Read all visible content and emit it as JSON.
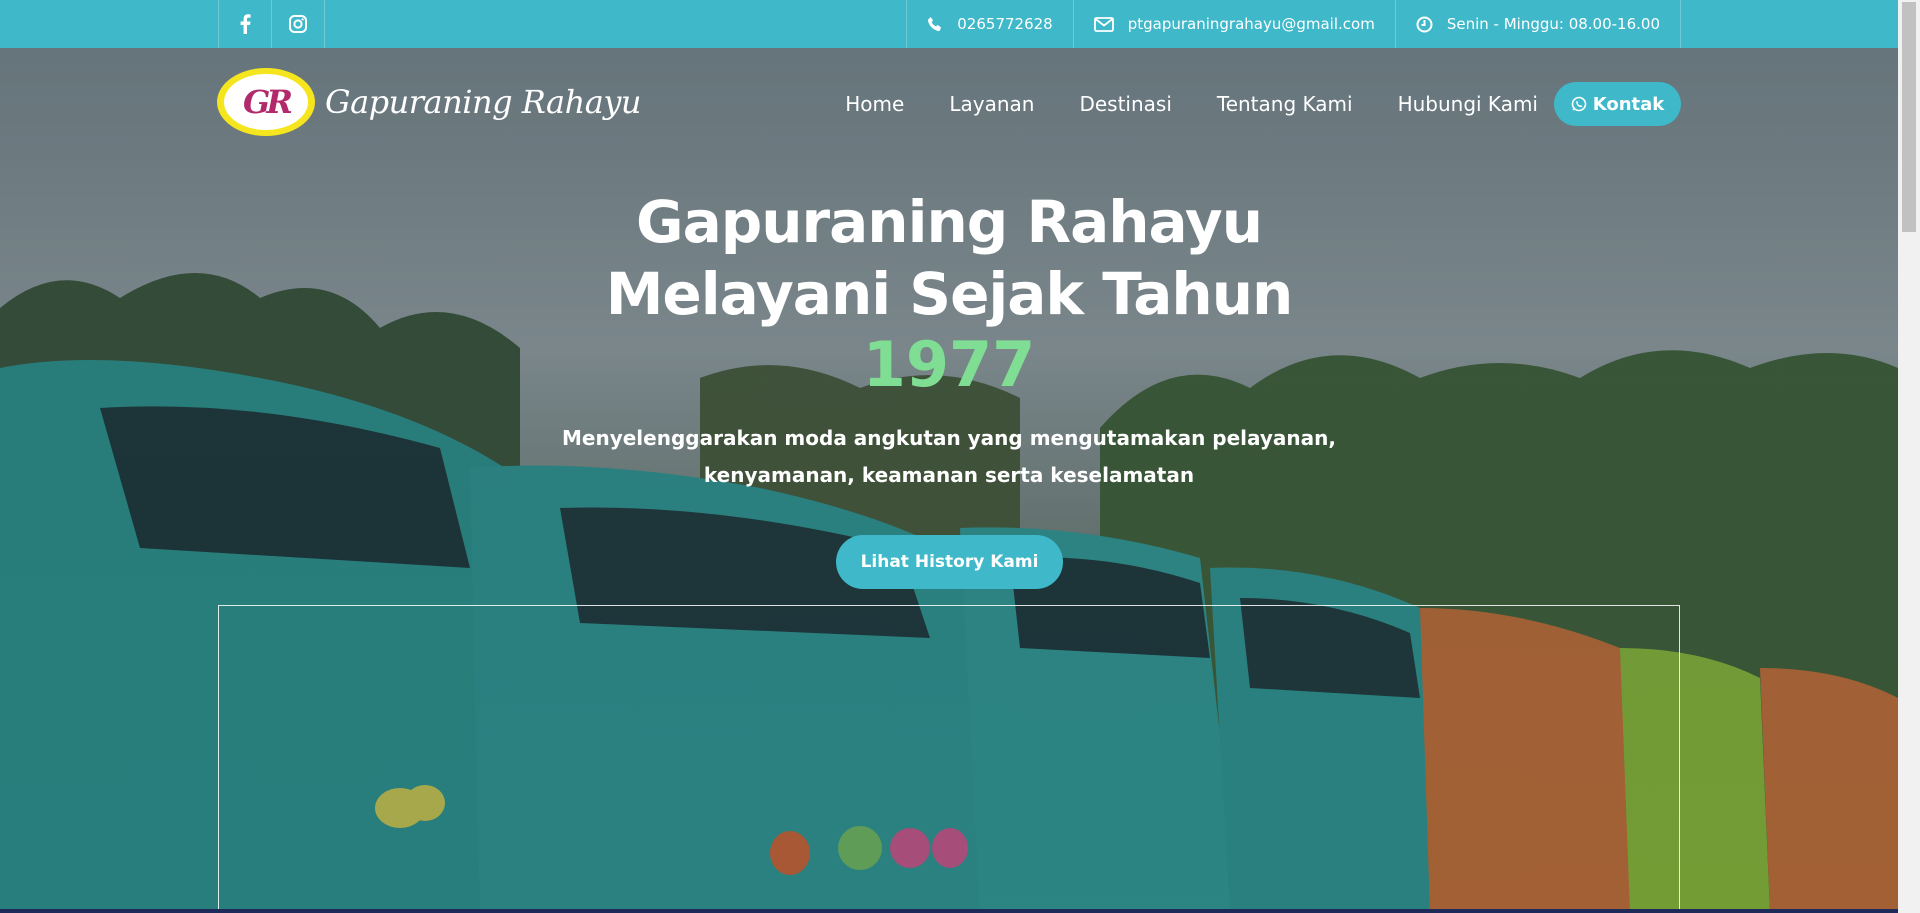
{
  "topbar": {
    "social": [
      {
        "icon": "facebook-icon"
      },
      {
        "icon": "instagram-icon"
      }
    ],
    "phone": "0265772628",
    "email": "ptgapuraningrahayu@gmail.com",
    "hours": "Senin - Minggu: 08.00-16.00"
  },
  "logo": {
    "monogram": "GR",
    "text": "Gapuraning Rahayu"
  },
  "nav": {
    "items": [
      "Home",
      "Layanan",
      "Destinasi",
      "Tentang Kami",
      "Hubungi Kami"
    ],
    "kontak": "Kontak"
  },
  "hero": {
    "title_line1": "Gapuraning Rahayu",
    "title_line2": "Melayani Sejak Tahun",
    "year": "1977",
    "lead_line1": "Menyelenggarakan moda angkutan yang mengutamakan pelayanan,",
    "lead_line2": "kenyamanan, keamanan serta keselamatan",
    "cta": "Lihat History Kami"
  },
  "colors": {
    "accent": "#3fb8c9",
    "year": "#7fde93",
    "logo_ring": "#f4e51f",
    "logo_mark": "#b22a6b"
  }
}
